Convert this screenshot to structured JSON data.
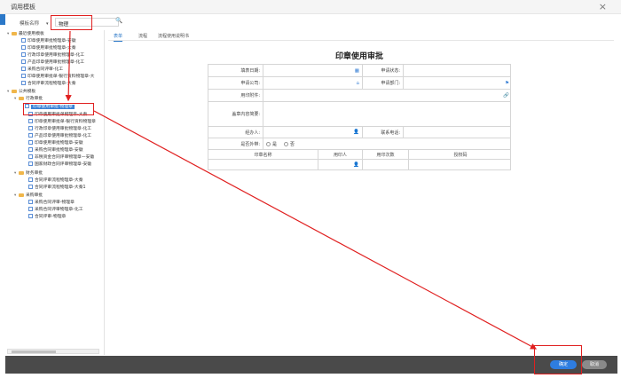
{
  "window": {
    "title": "调用模板",
    "close_glyph": "×"
  },
  "search": {
    "field_label": "模板名称",
    "query": "物理"
  },
  "tree": {
    "group_recent": "最近使用模板",
    "recent_items": [
      "印章使用审批物理章-安徽",
      "印章使用审批物理章-大秦",
      "行政印章使用审批物理章-化工",
      "产品印章使用审批物理章-化工",
      "采购合同评审-化工",
      "印章使用审批单-银行资料物理章-大",
      "合同评审流程物理章-大秦"
    ],
    "group_public": "公共模板",
    "group_admin": "行政审批",
    "admin_items": [
      "印章使用审批-物理章",
      "印章使用审批单物理章-大秦",
      "印章使用审批单-银行资料物理章",
      "行政印章使用审批物理章-化工",
      "产品印章使用审批物理章-化工",
      "印章使用审批物理章-安徽",
      "采购合同审批物理章-安徽",
      "非税资金合同评审物理章—安徽",
      "国家财政合同评审物理章-安徽"
    ],
    "group_finance": "财务审批",
    "finance_items": [
      "合同评审流程物理章-大秦",
      "合同评审流程物理章-大秦1"
    ],
    "group_purchase": "采购审批",
    "purchase_items": [
      "采购合同评审-物理章",
      "采购合同评审物理章-化工",
      "合同评审-物理章"
    ]
  },
  "tabs": [
    "表单",
    "流程",
    "流程使用说明书"
  ],
  "form": {
    "title": "印章使用审批",
    "fill_date": "填表日期:",
    "apply_status": "申请状态:",
    "apply_company": "申请公司:",
    "apply_dept": "申请部门:",
    "attachment": "用印附件:",
    "content_desc": "盖章内容简要:",
    "handler": "经办人:",
    "phone": "联系电话:",
    "take_out": "是否外带:",
    "yes": "是",
    "no": "否",
    "col_seal_name": "印章名称",
    "col_user": "用印人",
    "col_times": "用印次数",
    "col_code": "授权码"
  },
  "footer": {
    "ok": "确定",
    "cancel": "取消"
  },
  "colors": {
    "accent": "#2e7de0",
    "highlight": "#e02020",
    "footer_bg": "#4a4a4a"
  },
  "icons": [
    "close-icon",
    "search-icon",
    "folder-icon",
    "document-icon",
    "calendar-icon",
    "company-icon",
    "flag-icon",
    "attach-icon",
    "person-icon"
  ]
}
